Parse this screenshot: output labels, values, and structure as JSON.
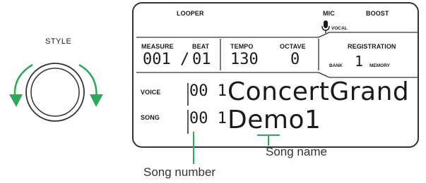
{
  "style_knob": {
    "label": "STYLE",
    "arrow_color": "#2fa85a"
  },
  "lcd": {
    "looper": "LOOPER",
    "mic": "MIC",
    "boost": "BOOST",
    "vocal": "VOCAL",
    "measure_label": "MEASURE",
    "beat_label": "BEAT",
    "measure_value": "001",
    "beat_separator": "/",
    "beat_value": "01",
    "tempo_label": "TEMPO",
    "tempo_value": "130",
    "octave_label": "OCTAVE",
    "octave_value": "0",
    "registration_label": "REGISTRATION",
    "bank_label": "BANK",
    "bank_value": "1",
    "memory_label": "MEMORY",
    "voice_label": "VOICE",
    "voice_number": "00 1",
    "voice_name": "ConcertGrand",
    "song_label": "SONG",
    "song_number": "00 1",
    "song_name": "Demo1"
  },
  "callouts": {
    "song_number": "Song number",
    "song_name": "Song name",
    "line_color": "#2fa85a"
  }
}
